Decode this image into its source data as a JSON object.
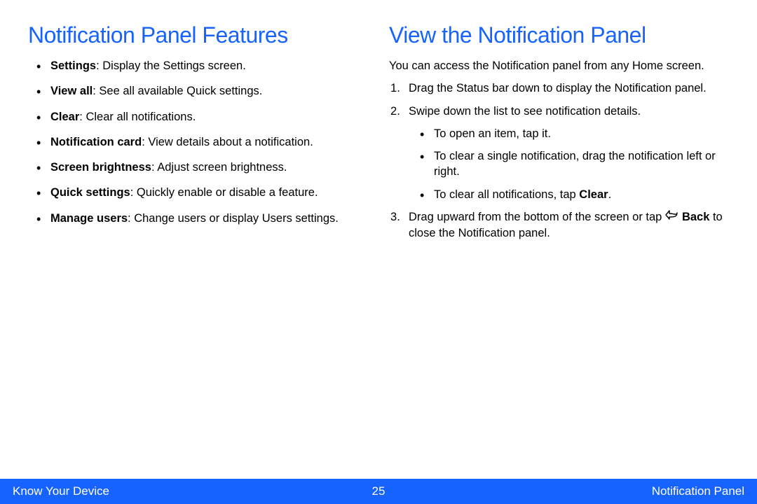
{
  "left": {
    "heading": "Notification Panel Features",
    "items": [
      {
        "term": "Settings",
        "desc": ": Display the Settings screen."
      },
      {
        "term": "View all",
        "desc": ": See all available Quick settings."
      },
      {
        "term": "Clear",
        "desc": ": Clear all notifications."
      },
      {
        "term": "Notification card",
        "desc": ": View details about a notification."
      },
      {
        "term": "Screen brightness",
        "desc": ": Adjust screen brightness."
      },
      {
        "term": "Quick settings",
        "desc": ": Quickly enable or disable a feature."
      },
      {
        "term": "Manage users",
        "desc": ": Change users or display Users settings."
      }
    ]
  },
  "right": {
    "heading": "View the Notification Panel",
    "intro": "You can access the Notification panel from any Home screen.",
    "step1": "Drag the Status bar down to display the Notification panel.",
    "step2": "Swipe down the list to see notification details.",
    "sub1": "To open an item, tap it.",
    "sub2": "To clear a single notification, drag the notification left or right.",
    "sub3_pre": "To clear all notifications, tap ",
    "sub3_bold": "Clear",
    "sub3_post": ".",
    "step3_pre": "Drag upward from the bottom of the screen or tap ",
    "step3_bold": "Back",
    "step3_post": " to close the Notification panel."
  },
  "footer": {
    "left": "Know Your Device",
    "page": "25",
    "right": "Notification Panel"
  }
}
